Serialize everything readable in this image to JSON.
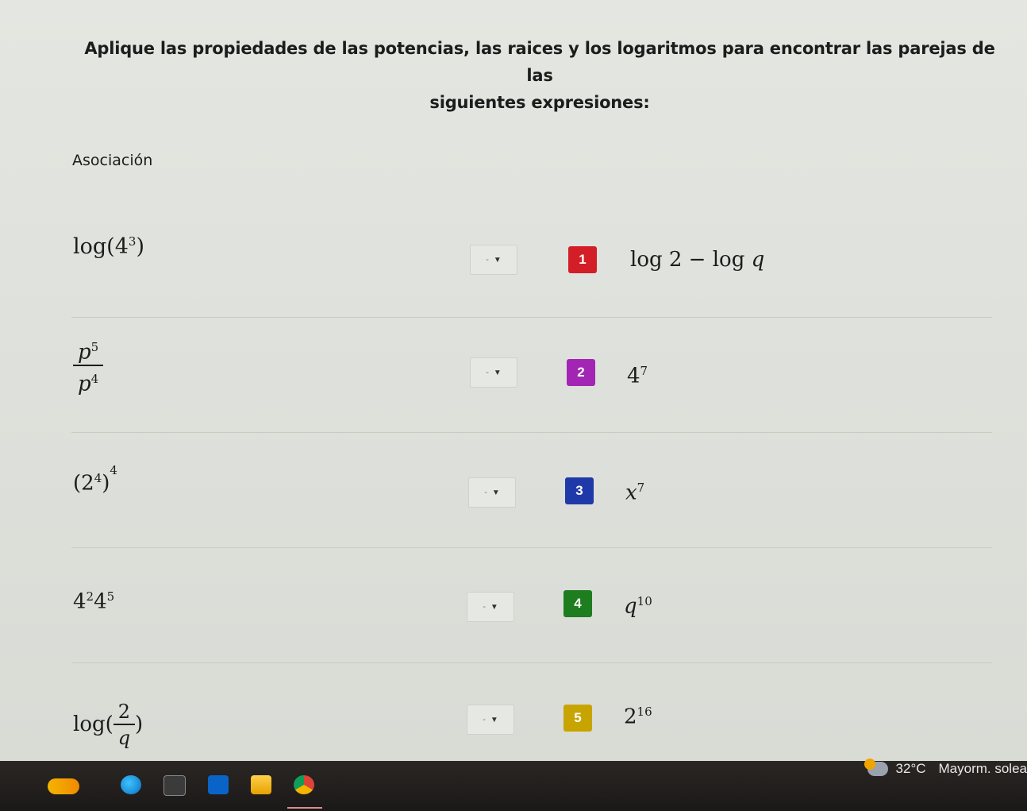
{
  "instructions": {
    "line1": "Aplique las propiedades de las potencias, las raices y los logaritmos para encontrar las parejas de las",
    "line2": "siguientes expresiones:"
  },
  "section_title": "Asociación",
  "select_placeholder": "-",
  "rows": [
    {
      "expr": "log(4^3)",
      "badge_number": "1",
      "badge_color": "#d41e27",
      "answer": "log 2 − log q"
    },
    {
      "expr": "p^5 / p^4",
      "badge_number": "2",
      "badge_color": "#a226b3",
      "answer": "4^7"
    },
    {
      "expr": "(2^4)^4",
      "badge_number": "3",
      "badge_color": "#1f3aa8",
      "answer": "x^7"
    },
    {
      "expr": "4^2 4^5",
      "badge_number": "4",
      "badge_color": "#1e7d1f",
      "answer": "q^10"
    },
    {
      "expr": "log(2/q)",
      "badge_number": "5",
      "badge_color": "#c8a400",
      "answer": "2^16"
    }
  ],
  "taskbar": {
    "temperature": "32°C",
    "weather_text": "Mayorm. solea",
    "icons": [
      "widgets-icon",
      "edge-icon",
      "calculator-icon",
      "outlook-icon",
      "folder-icon",
      "chrome-icon"
    ]
  }
}
